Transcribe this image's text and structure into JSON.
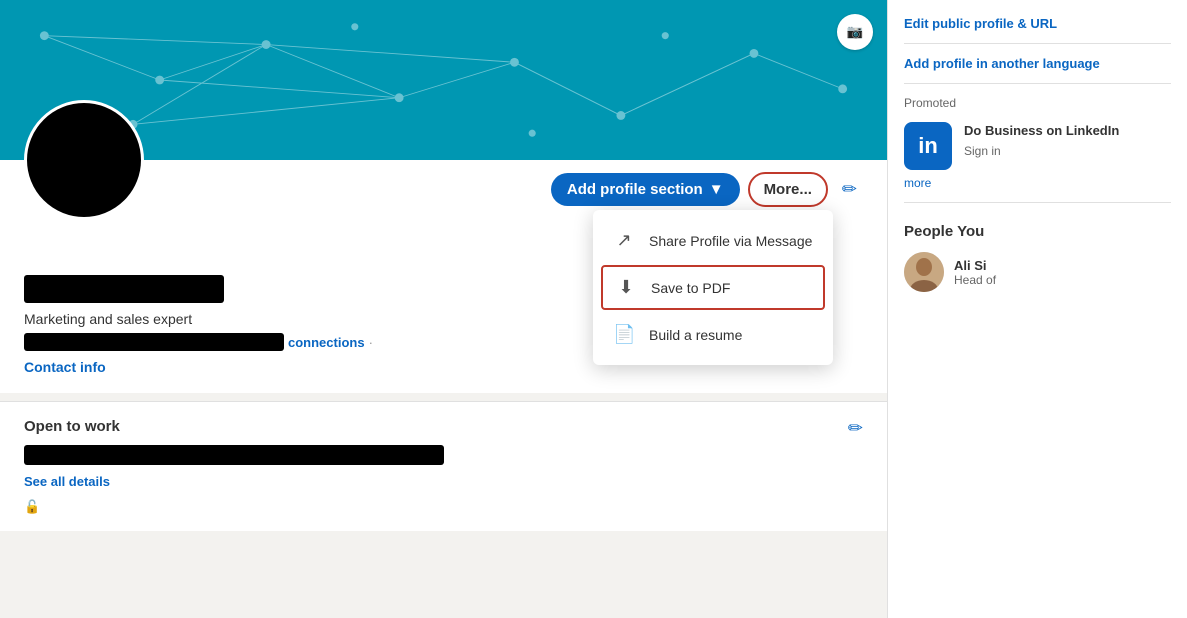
{
  "sidebar": {
    "edit_public_profile_label": "Edit public profile & URL",
    "add_profile_in_another_language": "Add profile in another language",
    "promoted_label": "Promoted",
    "li_logo_text": "in",
    "promo_title": "Do Business on LinkedIn",
    "promo_subtext": "Sign in",
    "more_label": "more",
    "people_you_may_know": "People You",
    "person_name": "Ali Si",
    "person_title": "Head of"
  },
  "profile": {
    "tagline": "Marketing and sales expert",
    "connections_label": "connections",
    "dot": "·",
    "contact_info_label": "Contact info",
    "add_profile_section_label": "Add profile section",
    "add_profile_chevron": "▼",
    "more_label": "More...",
    "open_to_work_label": "Open to work",
    "see_all_details_label": "See all details"
  },
  "dropdown": {
    "share_profile_label": "Share Profile via Message",
    "save_to_pdf_label": "Save to PDF",
    "build_resume_label": "Build a resume"
  },
  "icons": {
    "camera": "📷",
    "pencil": "✏",
    "share": "↗",
    "download": "⬇",
    "document": "📄"
  }
}
